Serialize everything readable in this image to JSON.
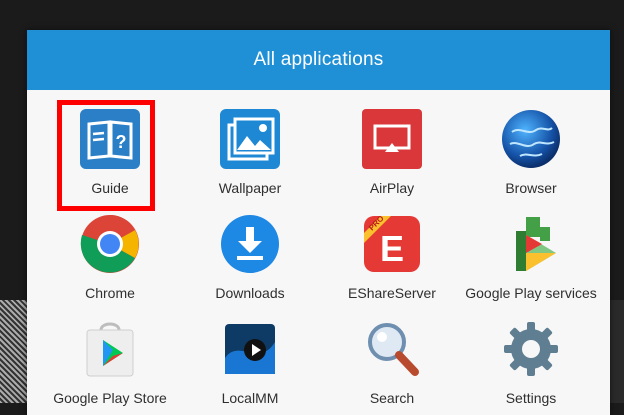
{
  "dialog": {
    "title": "All applications"
  },
  "apps": [
    {
      "label": "Guide",
      "icon": "guide-book-icon"
    },
    {
      "label": "Wallpaper",
      "icon": "wallpaper-icon"
    },
    {
      "label": "AirPlay",
      "icon": "airplay-icon"
    },
    {
      "label": "Browser",
      "icon": "browser-globe-icon"
    },
    {
      "label": "Chrome",
      "icon": "chrome-icon"
    },
    {
      "label": "Downloads",
      "icon": "downloads-icon"
    },
    {
      "label": "EShareServer",
      "icon": "eshare-icon"
    },
    {
      "label": "Google Play services",
      "icon": "google-play-services-icon"
    },
    {
      "label": "Google Play Store",
      "icon": "google-play-store-icon"
    },
    {
      "label": "LocalMM",
      "icon": "localmm-icon"
    },
    {
      "label": "Search",
      "icon": "search-icon"
    },
    {
      "label": "Settings",
      "icon": "settings-gear-icon"
    }
  ],
  "icon_text": {
    "eshare_letter": "E",
    "eshare_tag": "PRO"
  },
  "colors": {
    "header": "#1f8fd6",
    "highlight": "#ff0000"
  }
}
